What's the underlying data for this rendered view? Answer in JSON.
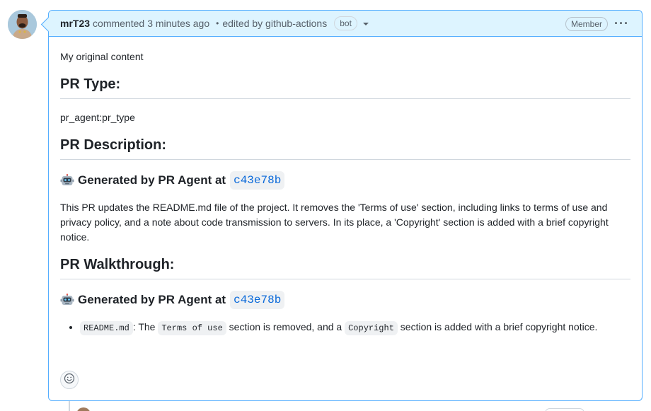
{
  "comment": {
    "author": "mrT23",
    "action": "commented",
    "time": "3 minutes ago",
    "separator": "•",
    "edited_by": "edited by github-actions",
    "bot_badge": "bot",
    "role_badge": "Member",
    "more": "···",
    "body": {
      "intro": "My original content",
      "pr_type_heading": "PR Type:",
      "pr_type_value": "pr_agent:pr_type",
      "pr_description_heading": "PR Description:",
      "generated_1": "Generated by PR Agent at",
      "sha_1": "c43e78b",
      "description": "This PR updates the README.md file of the project. It removes the 'Terms of use' section, including links to terms of use and privacy policy, and a note about code transmission to servers. In its place, a 'Copyright' section is added with a brief copyright notice.",
      "pr_walkthrough_heading": "PR Walkthrough:",
      "generated_2": "Generated by PR Agent at",
      "sha_2": "c43e78b",
      "walkthrough": {
        "file": "README.md",
        "text_1": ": The",
        "code_1": "Terms of use",
        "text_2": "section is removed, and a",
        "code_2": "Copyright",
        "text_3": "section is added with a brief copyright notice."
      }
    }
  },
  "icons": {
    "robot": "robot-icon",
    "smiley": "smiley-icon",
    "caret": "chevron-down-icon",
    "kebab": "kebab-horizontal-icon"
  },
  "colors": {
    "header_bg": "#ddf4ff",
    "border_accent": "#54aeff",
    "link": "#0969da"
  }
}
